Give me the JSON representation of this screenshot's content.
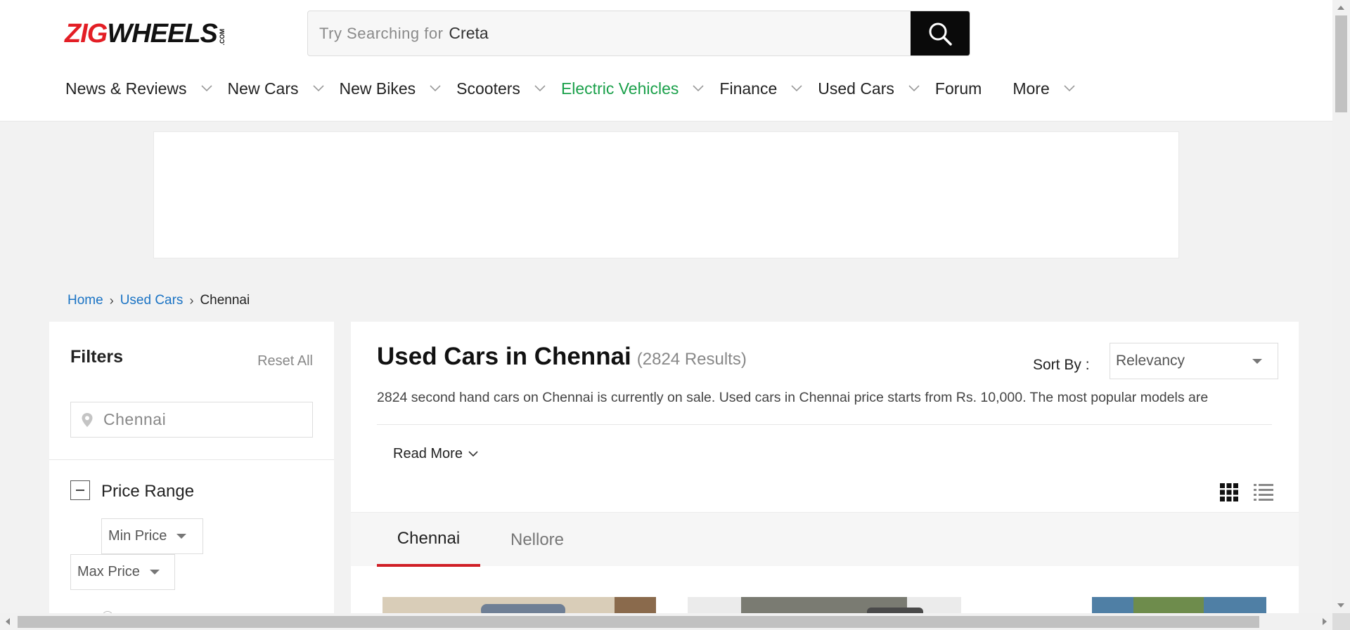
{
  "header": {
    "logo": {
      "part1": "ZIG",
      "part2": "WHEELS",
      "suffix": ".COM"
    },
    "search": {
      "placeholder": "Try Searching for",
      "value": "Creta"
    },
    "nav": [
      {
        "label": "News & Reviews",
        "has_dropdown": true
      },
      {
        "label": "New Cars",
        "has_dropdown": true
      },
      {
        "label": "New Bikes",
        "has_dropdown": true
      },
      {
        "label": "Scooters",
        "has_dropdown": true
      },
      {
        "label": "Electric Vehicles",
        "has_dropdown": true,
        "color": "#1aa04a"
      },
      {
        "label": "Finance",
        "has_dropdown": true
      },
      {
        "label": "Used Cars",
        "has_dropdown": true
      },
      {
        "label": "Forum",
        "has_dropdown": false
      },
      {
        "label": "More",
        "has_dropdown": true
      }
    ]
  },
  "breadcrumb": {
    "home": "Home",
    "section": "Used Cars",
    "current": "Chennai"
  },
  "filters": {
    "title": "Filters",
    "reset": "Reset All",
    "location": "Chennai",
    "price_range": {
      "label": "Price Range",
      "min": "Min Price",
      "max": "Max Price"
    }
  },
  "main": {
    "title": "Used Cars in Chennai",
    "count": "(2824 Results)",
    "sort_label": "Sort By :",
    "sort_value": "Relevancy",
    "description": "2824 second hand cars on Chennai is currently on sale. Used cars in Chennai price starts from Rs. 10,000. The most popular models are",
    "read_more": "Read More",
    "tabs": [
      "Chennai",
      "Nellore"
    ]
  },
  "colors": {
    "brand_red": "#e31e25",
    "accent_green": "#1aa04a",
    "link_blue": "#1a73c4",
    "tab_underline": "#d01f26"
  }
}
